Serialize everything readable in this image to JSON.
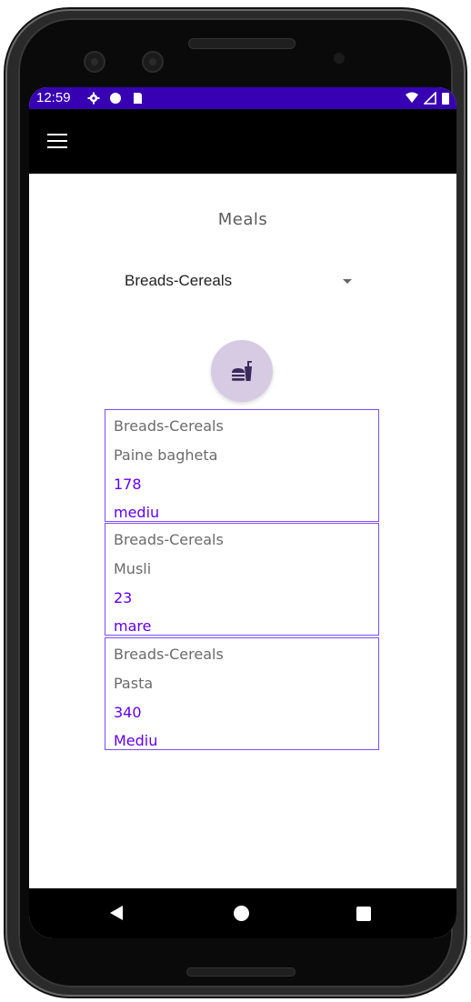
{
  "status_bar": {
    "time": "12:59",
    "left_icons": [
      "gear-icon",
      "circle-icon",
      "sd-card-icon"
    ],
    "right_icons": [
      "wifi-icon",
      "signal-icon",
      "battery-icon"
    ],
    "color": "#3700b3"
  },
  "app_bar": {
    "menu_icon": "menu-icon",
    "color": "#000000"
  },
  "main": {
    "title": "Meals",
    "dropdown": {
      "selected": "Breads-Cereals"
    },
    "fab_icon": "fastfood-icon",
    "meals": [
      {
        "category": "Breads-Cereals",
        "name": "Paine bagheta",
        "calories": "178",
        "size": "mediu"
      },
      {
        "category": "Breads-Cereals",
        "name": "Musli",
        "calories": "23",
        "size": "mare"
      },
      {
        "category": "Breads-Cereals",
        "name": "Pasta",
        "calories": "340",
        "size": "Mediu"
      }
    ]
  },
  "nav_bar": {
    "back_icon": "back-icon",
    "home_icon": "home-icon",
    "recent_icon": "recents-icon"
  },
  "colors": {
    "accent": "#6200ee",
    "card_border": "#7c4dff",
    "fab_bg": "#d6cbe3"
  }
}
